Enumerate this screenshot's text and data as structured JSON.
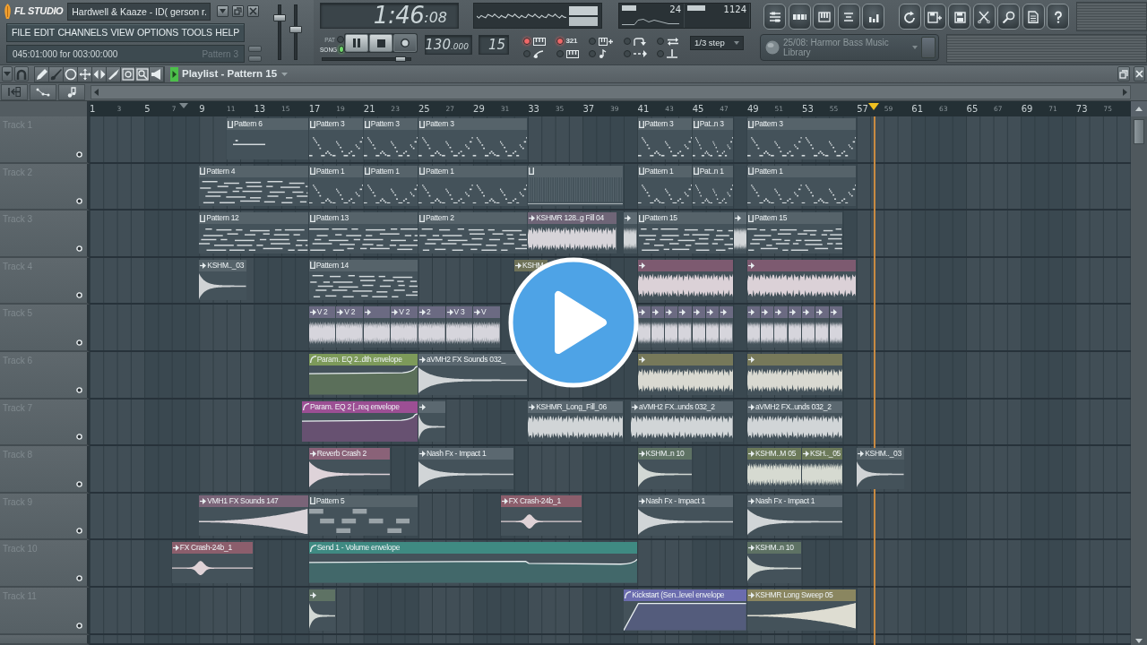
{
  "window": {
    "logo": "FL STUDIO",
    "title": "Hardwell & Kaaze - ID( gerson r."
  },
  "menu": [
    "FILE",
    "EDIT",
    "CHANNELS",
    "VIEW",
    "OPTIONS",
    "TOOLS",
    "HELP"
  ],
  "hint_bar": {
    "position": "045:01:000 for 003:00:000",
    "target": "Pattern 3"
  },
  "master_faders": [
    {
      "level": 0.8
    },
    {
      "level": 0.55
    }
  ],
  "transport": {
    "time": "1:46",
    "time_fraction": ":08",
    "modes": [
      {
        "label": "PAT",
        "selected": false
      },
      {
        "label": "SONG",
        "selected": true
      }
    ],
    "position": {
      "level": 0.92
    },
    "tempo": "130",
    "tempo_fraction": ".000",
    "pattern": "15"
  },
  "monitor": {
    "cpu": "24",
    "memory": "1124"
  },
  "record_options": {
    "countdown": "321",
    "switches": [
      {
        "on": true
      },
      {
        "on": true
      },
      {
        "on": false
      },
      {
        "on": false
      },
      {
        "on": false
      },
      {
        "on": false
      },
      {
        "on": false
      },
      {
        "on": false
      },
      {
        "on": false
      },
      {
        "on": false
      }
    ]
  },
  "snap": "1/3 step",
  "hint_panel": "25/08: Harmor Bass Music Library",
  "playlist": {
    "title": "Playlist - Pattern 15",
    "ruler": [
      "1",
      "3",
      "5",
      "7",
      "9",
      "11",
      "13",
      "15",
      "17",
      "19",
      "21",
      "23",
      "25",
      "27",
      "29",
      "31",
      "33",
      "35",
      "37",
      "39",
      "41",
      "43",
      "45",
      "47",
      "49",
      "51",
      "53",
      "55",
      "57",
      "59",
      "61",
      "63",
      "65",
      "67",
      "69",
      "71",
      "73",
      "75"
    ],
    "tracks": [
      {
        "name": "Track 1",
        "clips": [
          {
            "kind": "pattern",
            "label": "Pattern 6",
            "color": "#56636a"
          },
          {
            "kind": "pattern",
            "label": "Pattern 3",
            "color": "#56636a"
          },
          {
            "kind": "pattern",
            "label": "Pattern 3",
            "color": "#56636a"
          },
          {
            "kind": "pattern",
            "label": "Pattern 3",
            "color": "#56636a"
          },
          {
            "kind": "pattern",
            "label": "Pattern 3",
            "color": "#56636a"
          },
          {
            "kind": "pattern",
            "label": "Pat..n 3",
            "color": "#56636a"
          },
          {
            "kind": "pattern",
            "label": "Pattern 3",
            "color": "#56636a"
          }
        ]
      },
      {
        "name": "Track 2",
        "clips": [
          {
            "kind": "pattern",
            "label": "Pattern 4",
            "color": "#56636a"
          },
          {
            "kind": "pattern",
            "label": "Pattern 1",
            "color": "#56636a"
          },
          {
            "kind": "pattern",
            "label": "Pattern 1",
            "color": "#56636a"
          },
          {
            "kind": "pattern",
            "label": "Pattern 1",
            "color": "#56636a"
          },
          {
            "kind": "pattern",
            "color": "#56636a"
          },
          {
            "kind": "pattern",
            "label": "Pattern 1",
            "color": "#56636a"
          },
          {
            "kind": "pattern",
            "label": "Pat..n 1",
            "color": "#56636a"
          },
          {
            "kind": "pattern",
            "label": "Pattern 1",
            "color": "#56636a"
          }
        ]
      },
      {
        "name": "Track 3",
        "clips": [
          {
            "kind": "pattern",
            "label": "Pattern 12",
            "color": "#56636a"
          },
          {
            "kind": "pattern",
            "label": "Pattern 13",
            "color": "#56636a"
          },
          {
            "kind": "pattern",
            "label": "Pattern 2",
            "color": "#56636a"
          },
          {
            "kind": "audio",
            "label": "KSHMR 128..g Fill 04",
            "color": "#6f6577"
          },
          {
            "kind": "audio",
            "color": "#5d6a72"
          },
          {
            "kind": "pattern",
            "label": "Pattern 15",
            "color": "#56636a"
          },
          {
            "kind": "audio",
            "color": "#5d6a72"
          },
          {
            "kind": "pattern",
            "label": "Pattern 15",
            "color": "#56636a"
          }
        ]
      },
      {
        "name": "Track 4",
        "clips": [
          {
            "kind": "audio",
            "label": "KSHM.._03",
            "color": "#56636a"
          },
          {
            "kind": "pattern",
            "label": "Pattern 14",
            "color": "#56636a"
          },
          {
            "kind": "audio",
            "label": "KSHM",
            "color": "#6f7258"
          },
          {
            "kind": "audio",
            "color": "#7d5a70"
          },
          {
            "kind": "audio",
            "color": "#7d5a70"
          }
        ]
      },
      {
        "name": "Track 5",
        "clips": [
          {
            "kind": "audio",
            "label": "V 2",
            "color": "#6b6a82"
          },
          {
            "kind": "audio",
            "label": "V 2",
            "color": "#6b6a82"
          },
          {
            "kind": "audio",
            "color": "#6b6a82"
          },
          {
            "kind": "audio",
            "label": "V 2",
            "color": "#6b6a82"
          },
          {
            "kind": "audio",
            "label": "2",
            "color": "#6b6a82"
          },
          {
            "kind": "audio",
            "label": "V 3",
            "color": "#6b6a82"
          },
          {
            "kind": "audio",
            "label": "V",
            "color": "#6b6a82"
          },
          {
            "kind": "audio",
            "color": "#6b6a82"
          },
          {
            "kind": "audio",
            "color": "#6b6a82"
          },
          {
            "kind": "audio",
            "color": "#6b6a82"
          },
          {
            "kind": "audio",
            "color": "#6b6a82"
          },
          {
            "kind": "audio",
            "color": "#6b6a82"
          },
          {
            "kind": "audio",
            "color": "#6b6a82"
          },
          {
            "kind": "audio",
            "color": "#6b6a82"
          },
          {
            "kind": "audio",
            "color": "#6b6a82"
          },
          {
            "kind": "audio",
            "color": "#6b6a82"
          },
          {
            "kind": "audio",
            "color": "#6b6a82"
          },
          {
            "kind": "audio",
            "color": "#6b6a82"
          },
          {
            "kind": "audio",
            "color": "#6b6a82"
          },
          {
            "kind": "audio",
            "color": "#6b6a82"
          },
          {
            "kind": "audio",
            "color": "#6b6a82"
          }
        ]
      },
      {
        "name": "Track 6",
        "clips": [
          {
            "kind": "automation",
            "label": "Param. EQ 2..dth envelope",
            "color": "#7d9a5a"
          },
          {
            "kind": "audio",
            "label": "aVMH2 FX Sounds 032_",
            "color": "#5b6870"
          },
          {
            "kind": "audio",
            "color": "#77795a"
          },
          {
            "kind": "audio",
            "color": "#77795a"
          }
        ]
      },
      {
        "name": "Track 7",
        "clips": [
          {
            "kind": "automation",
            "label": "Param. EQ 2 [..req envelope",
            "color": "#9c4f94"
          },
          {
            "kind": "audio",
            "color": "#5b6870"
          },
          {
            "kind": "audio",
            "label": "KSHMR_Long_Fill_06",
            "color": "#5b6870"
          },
          {
            "kind": "audio",
            "label": "aVMH2 FX..unds 032_2",
            "color": "#5b6870"
          },
          {
            "kind": "audio",
            "label": "aVMH2 FX..unds 032_2",
            "color": "#5b6870"
          }
        ]
      },
      {
        "name": "Track 8",
        "clips": [
          {
            "kind": "audio",
            "label": "Reverb Crash 2",
            "color": "#8a6278"
          },
          {
            "kind": "audio",
            "label": "Nash Fx - Impact 1",
            "color": "#5b6870"
          },
          {
            "kind": "audio",
            "label": "KSHM..n 10",
            "color": "#5e7264"
          },
          {
            "kind": "audio",
            "label": "KSHM..M 05",
            "color": "#6c7a5a"
          },
          {
            "kind": "audio",
            "label": "KSH.._05",
            "color": "#6c7a5a"
          },
          {
            "kind": "audio",
            "label": "KSHM.._03",
            "color": "#56636a"
          }
        ]
      },
      {
        "name": "Track 9",
        "clips": [
          {
            "kind": "audio",
            "label": "VMH1 FX Sounds 147",
            "color": "#7a6478"
          },
          {
            "kind": "pattern",
            "label": "Pattern 5",
            "color": "#56636a"
          },
          {
            "kind": "audio",
            "label": "FX Crash-24b_1",
            "color": "#8c5e6c"
          },
          {
            "kind": "audio",
            "label": "Nash Fx - Impact 1",
            "color": "#5b6870"
          },
          {
            "kind": "audio",
            "label": "Nash Fx - Impact 1",
            "color": "#5b6870"
          }
        ]
      },
      {
        "name": "Track 10",
        "clips": [
          {
            "kind": "audio",
            "label": "FX Crash-24b_1",
            "color": "#8c5e6c"
          },
          {
            "kind": "automation",
            "label": "Send 1 - Volume envelope",
            "color": "#3f8a82"
          },
          {
            "kind": "audio",
            "label": "KSHM..n 10",
            "color": "#5e7264"
          }
        ]
      },
      {
        "name": "Track 11",
        "clips": [
          {
            "kind": "audio",
            "color": "#5e7264"
          },
          {
            "kind": "automation",
            "label": "Kickstart (Sen..level envelope",
            "color": "#6b6cae"
          },
          {
            "kind": "audio",
            "label": "KSHMR Long Sweep 05",
            "color": "#8a8660"
          }
        ]
      }
    ]
  }
}
